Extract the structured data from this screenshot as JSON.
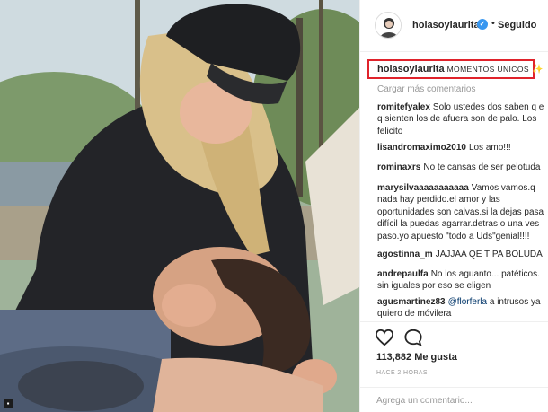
{
  "post": {
    "username": "holasoylaurita",
    "verified_mark": "✓",
    "separator": "•",
    "follow_status": "Seguido",
    "caption": {
      "username": "holasoylaurita",
      "text": "MOMENTOS UNICOS",
      "emoji": "✨"
    },
    "load_more": "Cargar más comentarios",
    "comments": [
      {
        "user": "romitefyalex",
        "lines": [
          "Solo ustedes dos saben q e",
          "q sienten los de afuera son de palo. Los",
          "felicito"
        ]
      },
      {
        "user": "lisandromaximo2010",
        "lines": [
          "Los amo!!!"
        ]
      },
      {
        "user": "rominaxrs",
        "lines": [
          "No te cansas de ser pelotuda"
        ]
      },
      {
        "user": "marysilvaaaaaaaaaaa",
        "lines": [
          "Vamos vamos.q",
          "nada hay perdido.el amor y las",
          "oportunidades son calvas.si la dejas pasa",
          "difícil la puedas agarrar.detras o una ves",
          "paso.yo apuesto \"todo a Uds\"genial!!!!"
        ]
      },
      {
        "user": "agostinna_m",
        "lines": [
          "JAJJAA QE TIPA BOLUDA"
        ]
      },
      {
        "user": "andrepaulfa",
        "lines": [
          "No los aguanto... patéticos.",
          "sin iguales por eso se eligen"
        ]
      },
      {
        "user": "agusmartinez83",
        "mention": "@florferla",
        "lines": [
          "a intrusos ya",
          "quiero de móvilera"
        ]
      }
    ],
    "likes": "113,882 Me gusta",
    "timestamp": "HACE 2 HORAS",
    "add_comment_placeholder": "Agrega un comentario...",
    "icons": [
      "heart-icon",
      "comment-icon",
      "verified-badge-icon"
    ],
    "accent_colors": {
      "verified": "#3897f0",
      "highlight_box": "#e0232b",
      "muted_text": "#999999"
    }
  }
}
